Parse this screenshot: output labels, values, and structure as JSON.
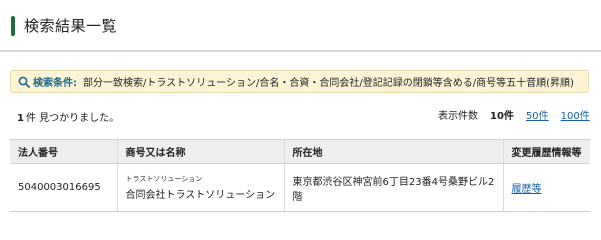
{
  "header": {
    "title": "検索結果一覧"
  },
  "conditions": {
    "icon": "search-icon",
    "label": "検索条件:",
    "value": "部分一致検索/トラストソリューション/合名・合資・合同会社/登記記録の閉鎖等含める/商号等五十音順(昇順)"
  },
  "results": {
    "count": "1",
    "count_suffix": "件 見つかりました。"
  },
  "per_page": {
    "label": "表示件数",
    "current": "10件",
    "options": [
      "50件",
      "100件"
    ]
  },
  "table": {
    "headers": [
      "法人番号",
      "商号又は名称",
      "所在地",
      "変更履歴情報等"
    ],
    "rows": [
      {
        "corp_number": "5040003016695",
        "name_kana": "トラストソリューション",
        "name": "合同会社トラストソリューション",
        "address": "東京都渋谷区神宮前6丁目23番4号桑野ビル2階",
        "history_link": "履歴等"
      }
    ]
  },
  "colors": {
    "accent": "#1e6b3e",
    "link": "#1a5fb4",
    "condition_bg": "#fbf5d5"
  }
}
